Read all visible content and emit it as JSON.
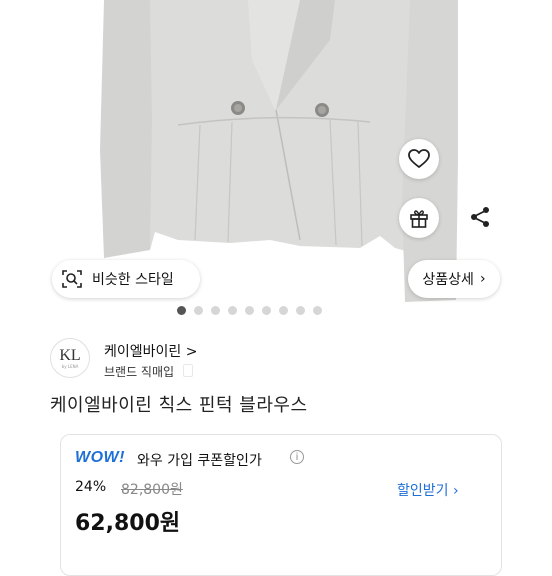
{
  "actions": {
    "similar_style_label": "비슷한 스타일",
    "product_detail_label": "상품상세",
    "product_detail_chevron": "›"
  },
  "icons": {
    "heart": "heart-icon",
    "gift": "gift-icon",
    "share": "share-icon",
    "similar_search": "image-search-icon"
  },
  "carousel": {
    "total": 9,
    "active_index": 0
  },
  "brand": {
    "logo_text": "KL",
    "logo_subtext": "by LENA",
    "name": "케이엘바이린 >",
    "type": "브랜드 직매입"
  },
  "product": {
    "title": "케이엘바이린 칙스 핀턱 블라우스"
  },
  "coupon": {
    "wow_label": "WOW!",
    "text": "와우 가입 쿠폰할인가",
    "info": "i",
    "discount_rate": "24%",
    "original_price": "82,800원",
    "sale_price": "62,800원",
    "link_label": "할인받기 ›"
  },
  "colors": {
    "accent": "#1f6fd6",
    "garment": "#dcdddb",
    "text": "#111111"
  }
}
